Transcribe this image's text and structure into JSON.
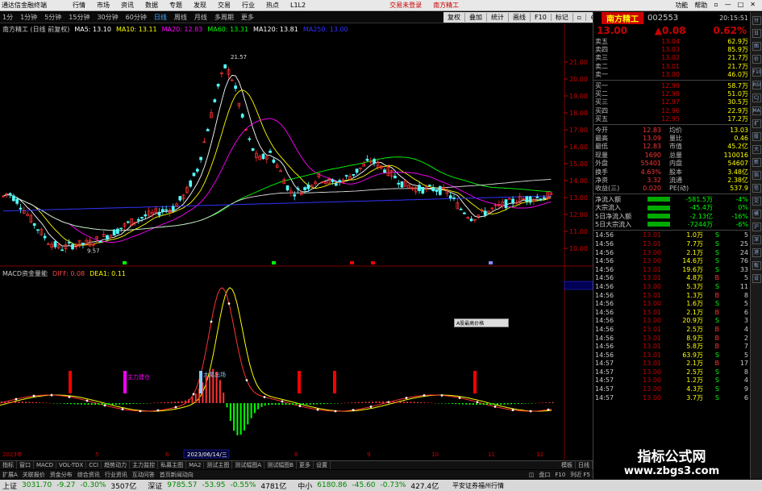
{
  "titlebar": {
    "app": "通达信金融终端",
    "menus": [
      "行情",
      "市场",
      "资讯",
      "数据",
      "专题",
      "发现",
      "交易",
      "行业",
      "热点",
      "L1L2"
    ],
    "center_left": "交易未登录",
    "center_right": "南方精工",
    "right": [
      "功能",
      "帮助",
      "▫",
      "—",
      "□",
      "✕"
    ]
  },
  "toolbar": {
    "periods": [
      "1分",
      "1分钟",
      "5分钟",
      "15分钟",
      "30分钟",
      "60分钟",
      "日线",
      "周线",
      "月线",
      "多周期",
      "更多"
    ],
    "active": "日线",
    "tools": [
      "复权",
      "叠加",
      "统计",
      "画线",
      "F10",
      "标记",
      "▫",
      "⊕"
    ]
  },
  "chart_info": {
    "name": "南方精工 (日线 前复权)",
    "ma": [
      {
        "label": "MA5: 13.10",
        "color": "#ffffff"
      },
      {
        "label": "MA10: 13.11",
        "color": "#ffff00"
      },
      {
        "label": "MA20: 12.83",
        "color": "#ff00ff"
      },
      {
        "label": "MA60: 13.31",
        "color": "#00ff00"
      },
      {
        "label": "MA120: 13.81",
        "color": "#ffffff"
      },
      {
        "label": "MA250: 13.00",
        "color": "#3333ff"
      }
    ]
  },
  "chart_data": {
    "type": "candlestick",
    "y_ticks": [
      "21.00",
      "20.00",
      "19.00",
      "18.00",
      "17.00",
      "16.00",
      "15.00",
      "14.00",
      "13.00",
      "12.00",
      "11.00",
      "10.00"
    ],
    "high_label": "21.57",
    "low_label": "9.57",
    "x_labels": [
      "2023年",
      "5",
      "6",
      "2023/06/14/三",
      "8",
      "9",
      "10",
      "11",
      "12"
    ]
  },
  "macd": {
    "title": "MACD资金量能",
    "diff": "DIFF: 0.08",
    "dea": "DEA1: 0.11",
    "annotations": [
      "主力建仓",
      "大尾出场"
    ],
    "scale": "1.67"
  },
  "tabs1": [
    "指标",
    "窗口",
    "MACD",
    "VOL-TDX",
    "CCI",
    "趋势动力",
    "主力监控",
    "私募主图",
    "MA2",
    "测试主图",
    "测试幅图A",
    "测试幅图B",
    "更多",
    "设置"
  ],
  "tabs1_right": [
    "模板",
    "日线"
  ],
  "tabs2": [
    "扩展A",
    "关联报价",
    "资金分布",
    "综合资讯",
    "行业资讯",
    "互动问答",
    "首页新闻动向"
  ],
  "tabs2_right": [
    "◫",
    "盘口",
    "F10",
    "列近 F5"
  ],
  "index": [
    {
      "name": "上证",
      "value": "3031.70",
      "chg": "-9.27",
      "pct": "-0.30%",
      "amt": "3507亿"
    },
    {
      "name": "深证",
      "value": "9785.57",
      "chg": "-53.95",
      "pct": "-0.55%",
      "amt": "4781亿"
    },
    {
      "name": "中小",
      "value": "6180.86",
      "chg": "-45.60",
      "pct": "-0.73%",
      "amt": "427.4亿"
    }
  ],
  "broker": "平安证券福州行情",
  "popup": "A股最高价格",
  "panel": {
    "name": "南方精工",
    "code": "002553",
    "price": "13.00",
    "change": "▲0.08",
    "pct": "0.62%",
    "asks": [
      {
        "l": "卖五",
        "p": "13.04",
        "v": "62.9万"
      },
      {
        "l": "卖四",
        "p": "13.03",
        "v": "85.9万"
      },
      {
        "l": "卖三",
        "p": "13.02",
        "v": "21.7万"
      },
      {
        "l": "卖二",
        "p": "13.01",
        "v": "21.7万"
      },
      {
        "l": "卖一",
        "p": "13.00",
        "v": "46.0万"
      }
    ],
    "bids": [
      {
        "l": "买一",
        "p": "12.99",
        "v": "58.7万"
      },
      {
        "l": "买二",
        "p": "12.98",
        "v": "51.0万"
      },
      {
        "l": "买三",
        "p": "12.97",
        "v": "30.5万"
      },
      {
        "l": "买四",
        "p": "12.96",
        "v": "22.9万"
      },
      {
        "l": "买五",
        "p": "12.95",
        "v": "17.2万"
      }
    ],
    "stats": [
      [
        "今开",
        "12.83",
        "均价",
        "13.03"
      ],
      [
        "最高",
        "13.09",
        "量比",
        "0.46"
      ],
      [
        "最低",
        "12.83",
        "市值",
        "45.2亿"
      ],
      [
        "现量",
        "1690",
        "总量",
        "110016"
      ],
      [
        "外盘",
        "55401",
        "内盘",
        "54607"
      ],
      [
        "换手",
        "4.63%",
        "股本",
        "3.48亿"
      ],
      [
        "净资",
        "3.32",
        "流通",
        "2.38亿"
      ],
      [
        "收益(三)",
        "0.020",
        "PE(动)",
        "537.9"
      ]
    ],
    "flows": [
      {
        "l": "净流入额",
        "v": "-581.5万",
        "p": "-4%"
      },
      {
        "l": "大宗流入",
        "v": "-45.4万",
        "p": "0%"
      },
      {
        "l": "5日净流入额",
        "v": "-2.13亿",
        "p": "-16%"
      },
      {
        "l": "5日大宗流入",
        "v": "-7244万",
        "p": "-6%"
      }
    ],
    "ticks": [
      {
        "t": "14:56",
        "p": "13.01",
        "q": "1.0万",
        "s": "S",
        "n": "5"
      },
      {
        "t": "14:56",
        "p": "13.01",
        "q": "7.7万",
        "s": "S",
        "n": "25"
      },
      {
        "t": "14:56",
        "p": "13.00",
        "q": "2.1万",
        "s": "S",
        "n": "24"
      },
      {
        "t": "14:56",
        "p": "13.00",
        "q": "14.6万",
        "s": "S",
        "n": "76"
      },
      {
        "t": "14:56",
        "p": "13.01",
        "q": "19.6万",
        "s": "S",
        "n": "33"
      },
      {
        "t": "14:56",
        "p": "13.01",
        "q": "4.8万",
        "s": "B",
        "n": "5"
      },
      {
        "t": "14:56",
        "p": "13.00",
        "q": "5.3万",
        "s": "S",
        "n": "11"
      },
      {
        "t": "14:56",
        "p": "13.01",
        "q": "1.3万",
        "s": "B",
        "n": "8"
      },
      {
        "t": "14:56",
        "p": "13.00",
        "q": "1.6万",
        "s": "S",
        "n": "5"
      },
      {
        "t": "14:56",
        "p": "13.01",
        "q": "2.1万",
        "s": "B",
        "n": "6"
      },
      {
        "t": "14:56",
        "p": "13.00",
        "q": "20.9万",
        "s": "S",
        "n": "3"
      },
      {
        "t": "14:56",
        "p": "13.01",
        "q": "2.5万",
        "s": "B",
        "n": "4"
      },
      {
        "t": "14:56",
        "p": "13.01",
        "q": "8.9万",
        "s": "B",
        "n": "2"
      },
      {
        "t": "14:56",
        "p": "13.01",
        "q": "5.8万",
        "s": "B",
        "n": "7"
      },
      {
        "t": "14:56",
        "p": "13.01",
        "q": "63.9万",
        "s": "S",
        "n": "5"
      },
      {
        "t": "14:57",
        "p": "13.01",
        "q": "2.1万",
        "s": "B",
        "n": "17"
      },
      {
        "t": "14:57",
        "p": "13.00",
        "q": "2.5万",
        "s": "S",
        "n": "8"
      },
      {
        "t": "14:57",
        "p": "13.00",
        "q": "1.2万",
        "s": "S",
        "n": "4"
      },
      {
        "t": "14:57",
        "p": "13.00",
        "q": "4.3万",
        "s": "S",
        "n": "9"
      },
      {
        "t": "14:57",
        "p": "13.00",
        "q": "3.7万",
        "s": "S",
        "n": "6"
      }
    ],
    "clock": "20:15:51"
  },
  "sidebar": [
    "分",
    "日",
    "图",
    "价",
    "F10",
    "RSI",
    "CJ",
    "MA",
    "扩",
    "股",
    "大",
    "新",
    "指",
    "信",
    "交",
    "模",
    "沪",
    "深",
    "港",
    "板",
    "设"
  ],
  "watermark": {
    "t1": "指标公式网",
    "t2": "www.zbgs3.com"
  }
}
